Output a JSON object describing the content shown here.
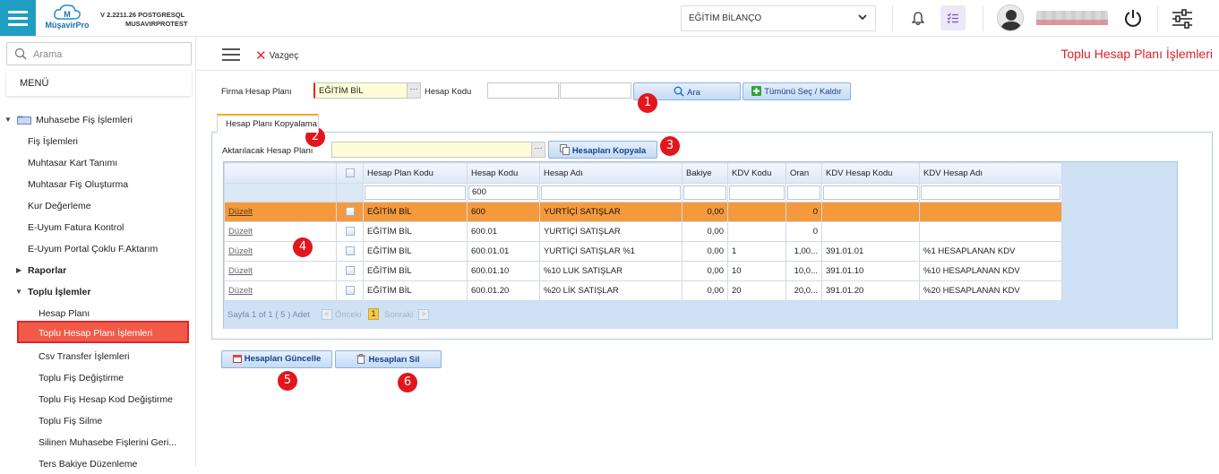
{
  "app": {
    "logo_text": "MüşavirPro",
    "version_line1": "V 2.2211.26 POSTGRESQL",
    "version_line2": "MUSAVIRPROTEST",
    "company_selected": "EĞİTİM BİLANÇO"
  },
  "sidebar": {
    "search_placeholder": "Arama",
    "menu_title": "MENÜ",
    "items": [
      {
        "label": "Muhasebe Fiş İşlemleri",
        "level": 0,
        "group": true,
        "expanded": true
      },
      {
        "label": "Fiş İşlemleri",
        "level": 1
      },
      {
        "label": "Muhtasar Kart Tanımı",
        "level": 1
      },
      {
        "label": "Muhtasar Fiş Oluşturma",
        "level": 1
      },
      {
        "label": "Kur Değerleme",
        "level": 1
      },
      {
        "label": "E-Uyum Fatura Kontrol",
        "level": 1
      },
      {
        "label": "E-Uyum Portal Çoklu F.Aktarım",
        "level": 1
      },
      {
        "label": "Raporlar",
        "level": 1,
        "group": true,
        "expanded": false
      },
      {
        "label": "Toplu İşlemler",
        "level": 1,
        "group": true,
        "expanded": true
      },
      {
        "label": "Hesap Planı",
        "level": 2
      },
      {
        "label": "Toplu Hesap Planı İşlemleri",
        "level": 2,
        "active": true
      },
      {
        "label": "Csv Transfer İşlemleri",
        "level": 2
      },
      {
        "label": "Toplu Fiş Değiştirme",
        "level": 2
      },
      {
        "label": "Toplu Fiş Hesap Kod Değiştirme",
        "level": 2
      },
      {
        "label": "Toplu Fiş Silme",
        "level": 2
      },
      {
        "label": "Silinen Muhasebe Fişlerini Geri...",
        "level": 2
      },
      {
        "label": "Ters Bakiye Düzenleme",
        "level": 2
      }
    ]
  },
  "toolbar": {
    "cancel_label": "Vazgeç",
    "page_title": "Toplu Hesap Planı İşlemleri"
  },
  "form": {
    "firma_label": "Firma Hesap Planı",
    "firma_value": "EĞİTİM BİL",
    "hesap_kodu_label": "Hesap Kodu",
    "hesap_kodu_from": "",
    "hesap_kodu_to": "",
    "search_button": "Ara",
    "select_all_button": "Tümünü Seç / Kaldır"
  },
  "copy_tab": {
    "tab_label": "Hesap Planı Kopyalama",
    "target_label": "Aktarılacak Hesap Planı",
    "target_value": "",
    "copy_button": "Hesapları Kopyala"
  },
  "grid": {
    "columns": [
      "",
      "",
      "Hesap Plan Kodu",
      "Hesap Kodu",
      "Hesap Adı",
      "Bakiye",
      "KDV Kodu",
      "Oran",
      "KDV Hesap Kodu",
      "KDV Hesap Adı"
    ],
    "filter_hesap_kodu": "600",
    "rows": [
      {
        "edit": "Düzelt",
        "plan": "EĞİTİM BİL",
        "kod": "600",
        "ad": "YURTİÇİ SATIŞLAR",
        "bakiye": "0,00",
        "kdv_kodu": "",
        "oran": "0",
        "kdv_hesap_kodu": "",
        "kdv_hesap_adi": "",
        "selected": true
      },
      {
        "edit": "Düzelt",
        "plan": "EĞİTİM BİL",
        "kod": "600.01",
        "ad": "YURTİÇİ SATIŞLAR",
        "bakiye": "0,00",
        "kdv_kodu": "",
        "oran": "0",
        "kdv_hesap_kodu": "",
        "kdv_hesap_adi": ""
      },
      {
        "edit": "Düzelt",
        "plan": "EĞİTİM BİL",
        "kod": "600.01.01",
        "ad": "YURTİÇİ SATIŞLAR %1",
        "bakiye": "0,00",
        "kdv_kodu": "1",
        "oran": "1,00...",
        "kdv_hesap_kodu": "391.01.01",
        "kdv_hesap_adi": "%1 HESAPLANAN KDV"
      },
      {
        "edit": "Düzelt",
        "plan": "EĞİTİM BİL",
        "kod": "600.01.10",
        "ad": "%10 LUK SATIŞLAR",
        "bakiye": "0,00",
        "kdv_kodu": "10",
        "oran": "10,0...",
        "kdv_hesap_kodu": "391.01.10",
        "kdv_hesap_adi": "%10 HESAPLANAN KDV"
      },
      {
        "edit": "Düzelt",
        "plan": "EĞİTİM BİL",
        "kod": "600.01.20",
        "ad": "%20 LİK SATIŞLAR",
        "bakiye": "0,00",
        "kdv_kodu": "20",
        "oran": "20,0...",
        "kdv_hesap_kodu": "391.01.20",
        "kdv_hesap_adi": "%20 HESAPLANAN KDV"
      }
    ],
    "pager_info": "Sayfa 1 of 1 ( 5 ) Adet",
    "pager_prev": "Önceki",
    "pager_current": "1",
    "pager_next": "Sonraki"
  },
  "actions": {
    "update_button": "Hesapları Güncelle",
    "delete_button": "Hesapları Sil"
  },
  "annotations": [
    "1",
    "2",
    "3",
    "4",
    "5",
    "6"
  ],
  "colors": {
    "accent": "#1f9ec1",
    "title_red": "#d9232a",
    "selected_row": "#f59a3c",
    "active_nav": "#f25a48",
    "badge": "#e2161c"
  }
}
